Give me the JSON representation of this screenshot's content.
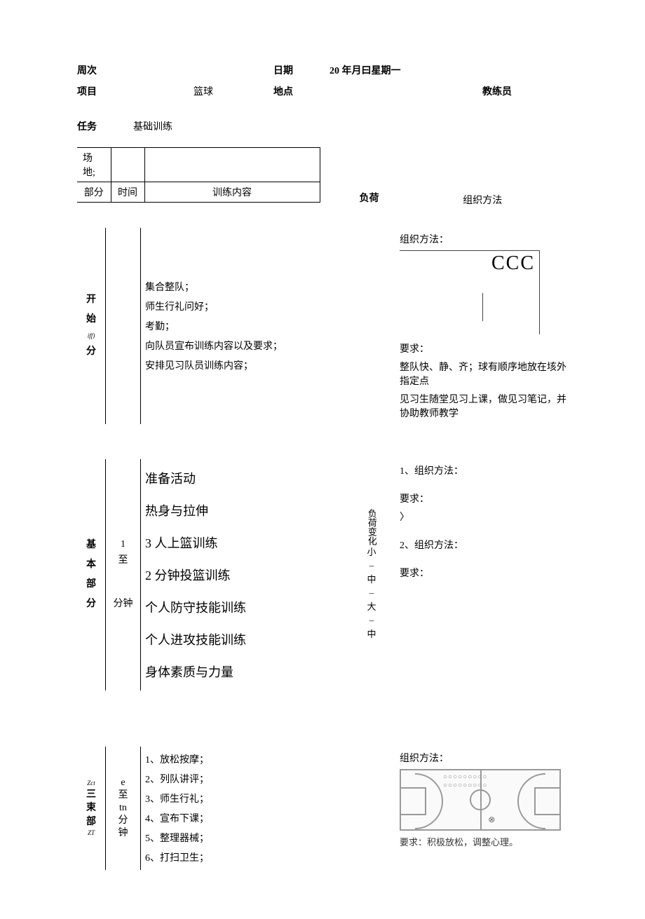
{
  "header": {
    "week_label": "周次",
    "date_label": "日期",
    "date_value": "20 年月曰星期一",
    "project_label": "项目",
    "project_value": "篮球",
    "location_label": "地点",
    "coach_label": "教练员",
    "task_label": "任务",
    "task_value": "基础训练"
  },
  "mini": {
    "venue_label": "场地;",
    "part_label": "部分",
    "time_label": "时间",
    "content_label": "训练内容"
  },
  "global": {
    "load_label": "负荷",
    "method_label": "组织方法"
  },
  "start": {
    "part_c1": "开",
    "part_c2": "始",
    "part_small": "iff)",
    "part_c3": "分",
    "items": [
      "集合整队；",
      "师生行礼问好；",
      "考勤；",
      "向队员宣布训练内容以及要求；",
      "安排见习队员训练内容；"
    ],
    "method_title": "组织方法：",
    "ccc": "CCC",
    "req_label": "要求：",
    "req1": "整队快、静、齐；球有顺序地放在垓外指定点",
    "req2": "见习生随堂见习上课，做见习笔记，并协助教师教学"
  },
  "basic": {
    "part_c1": "基",
    "part_c2": "本",
    "part_c3": "部",
    "part_c4": "分",
    "time_top": "1",
    "time_mid": "至",
    "time_bot": "分钟",
    "items": [
      "准备活动",
      "热身与拉伸",
      "3 人上篮训练",
      "2 分钟投篮训练",
      "个人防守技能训练",
      "个人进攻技能训练",
      "身体素质与力量"
    ],
    "load_top": "负荷变化",
    "load_seq": "小 – 中 – 大 – 中",
    "m1": "1、组织方法：",
    "r1": "要求：",
    "r1b": "〉",
    "m2": "2、组织方法：",
    "r2": "要求："
  },
  "end": {
    "part_small1": "Zct",
    "part_c1": "三",
    "part_c2": "束",
    "part_c3": "部",
    "part_small2": "ZT",
    "time_a": "e",
    "time_b": "至",
    "time_c": "tn",
    "time_d": "分",
    "time_e": "钟",
    "items": [
      "1、放松按摩；",
      "2、列队讲评；",
      "3、师生行礼；",
      "4、宣布下课；",
      "5、整理器械；",
      "6、打扫卫生；"
    ],
    "method_title": "组织方法：",
    "caption": "要求：积极放松，调整心理。"
  }
}
